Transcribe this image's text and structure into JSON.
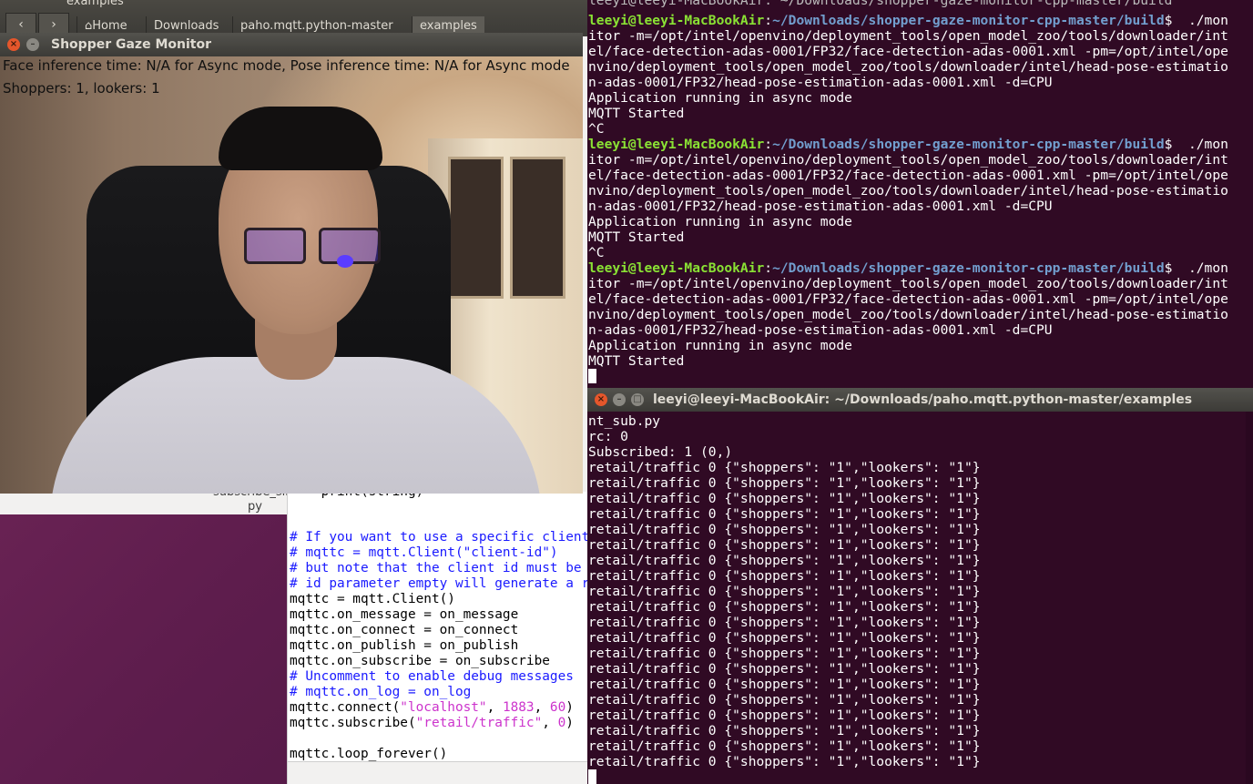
{
  "files_window": {
    "title": "examples",
    "back_glyph": "‹",
    "forward_glyph": "›",
    "breadcrumbs": [
      "⌂Home",
      "Downloads",
      "paho.mqtt.python-master",
      "examples"
    ],
    "file_label_line1": "subscribe_sim",
    "file_label_line2": "py"
  },
  "editor": {
    "partial_top_line": "    print(string)",
    "lines": [
      {
        "text": "# If you want to use a specific client id, use",
        "kind": "comment"
      },
      {
        "text": "# mqttc = mqtt.Client(\"client-id\")",
        "kind": "comment"
      },
      {
        "text": "# but note that the client id must be unique on the broker. Leaving the client",
        "kind": "comment"
      },
      {
        "text": "# id parameter empty will generate a random id for you.",
        "kind": "comment"
      },
      {
        "text": "mqttc = mqtt.Client()",
        "kind": "code"
      },
      {
        "text": "mqttc.on_message = on_message",
        "kind": "code"
      },
      {
        "text": "mqttc.on_connect = on_connect",
        "kind": "code"
      },
      {
        "text": "mqttc.on_publish = on_publish",
        "kind": "code"
      },
      {
        "text": "mqttc.on_subscribe = on_subscribe",
        "kind": "code"
      },
      {
        "text": "# Uncomment to enable debug messages",
        "kind": "comment"
      },
      {
        "text": "# mqttc.on_log = on_log",
        "kind": "comment"
      }
    ],
    "connect_prefix": "mqttc.connect(",
    "connect_host": "\"localhost\"",
    "connect_sep1": ", ",
    "connect_port": "1883",
    "connect_sep2": ", ",
    "connect_keepalive": "60",
    "connect_suffix": ")",
    "subscribe_prefix": "mqttc.subscribe(",
    "subscribe_topic": "\"retail/traffic\"",
    "subscribe_sep": ", ",
    "subscribe_qos": "0",
    "subscribe_suffix": ")",
    "loop_line": "mqttc.loop_forever()"
  },
  "gaze_window": {
    "title": "Shopper Gaze Monitor",
    "close_glyph": "×",
    "min_glyph": "–",
    "inference_text": "Face inference time: N/A for Async mode, Pose inference time: N/A for Async mode",
    "counts_text": "Shoppers: 1, lookers: 1"
  },
  "terminal1": {
    "prompt_user": "leeyi@leeyi-MacBookAir",
    "prompt_sep": ":",
    "prompt_path": "~/Downloads/shopper-gaze-monitor-cpp-master/build",
    "prompt_dollar": "$  ./mon",
    "command_wrapped": [
      "itor -m=/opt/intel/openvino/deployment_tools/open_model_zoo/tools/downloader/int",
      "el/face-detection-adas-0001/FP32/face-detection-adas-0001.xml -pm=/opt/intel/ope",
      "nvino/deployment_tools/open_model_zoo/tools/downloader/intel/head-pose-estimatio",
      "n-adas-0001/FP32/head-pose-estimation-adas-0001.xml -d=CPU"
    ],
    "output_async": "Application running in async mode",
    "output_mqtt": "MQTT Started",
    "interrupt": "^C",
    "top_title": "leeyi@leeyi-MacBookAir: ~/Downloads/shopper-gaze-monitor-cpp-master/build"
  },
  "terminal2": {
    "title": "leeyi@leeyi-MacBookAir: ~/Downloads/paho.mqtt.python-master/examples",
    "close_glyph": "×",
    "min_glyph": "–",
    "max_glyph": "□",
    "header_lines": [
      "nt_sub.py",
      "rc: 0",
      "Subscribed: 1 (0,)"
    ],
    "message": "retail/traffic 0 {\"shoppers\": \"1\",\"lookers\": \"1\"}",
    "message_count": 20
  }
}
